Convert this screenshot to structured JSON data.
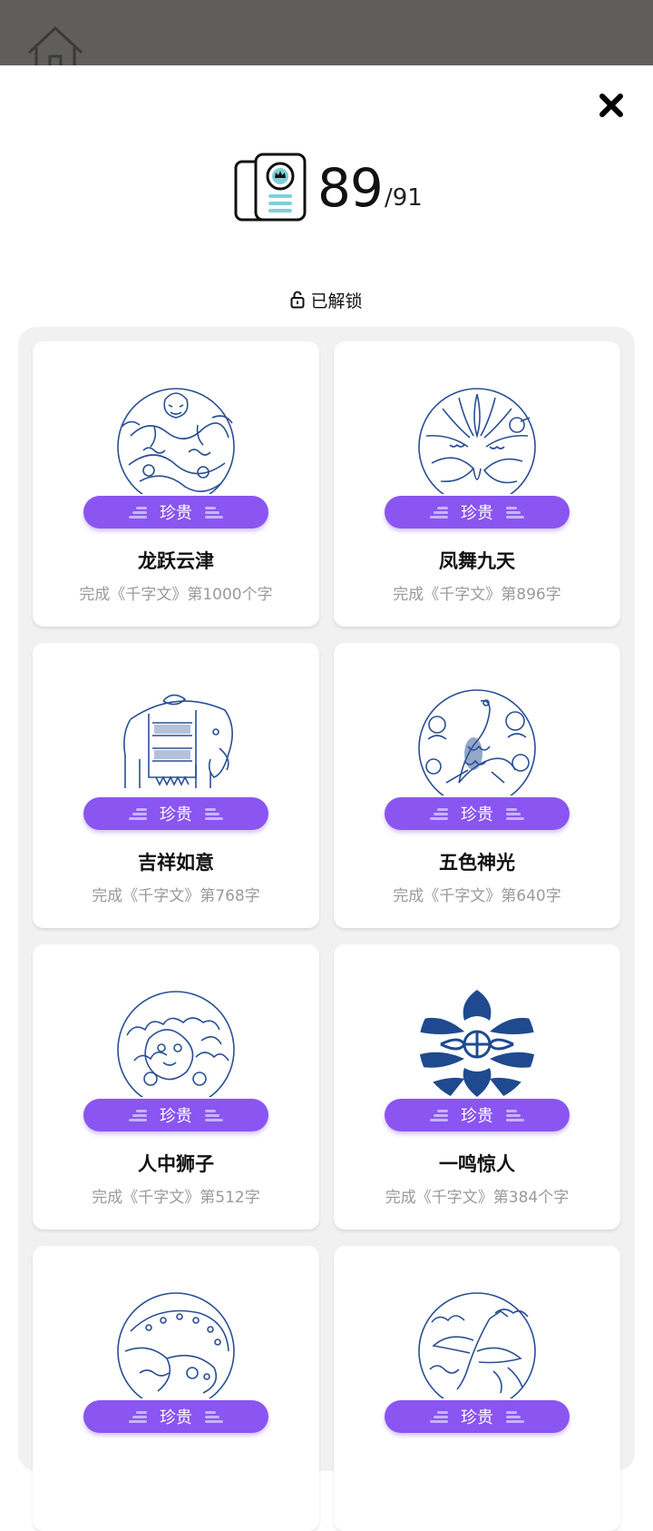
{
  "app": {
    "close_icon": "close-icon",
    "home_icon": "home-icon"
  },
  "counter": {
    "unlocked": "89",
    "total": "/91"
  },
  "unlocked_section": {
    "label": "已解锁",
    "icon": "unlock-icon"
  },
  "colors": {
    "badge": "#8a55f0",
    "art": "#2a4f94",
    "panel": "#f1f1f1"
  },
  "cards": [
    {
      "badge": "珍贵",
      "title": "龙跃云津",
      "desc": "完成《千字文》第1000个字",
      "art": "dragon"
    },
    {
      "badge": "珍贵",
      "title": "凤舞九天",
      "desc": "完成《千字文》第896字",
      "art": "phoenix"
    },
    {
      "badge": "珍贵",
      "title": "吉祥如意",
      "desc": "完成《千字文》第768字",
      "art": "elephant"
    },
    {
      "badge": "珍贵",
      "title": "五色神光",
      "desc": "完成《千字文》第640字",
      "art": "peacock"
    },
    {
      "badge": "珍贵",
      "title": "人中狮子",
      "desc": "完成《千字文》第512字",
      "art": "lion"
    },
    {
      "badge": "珍贵",
      "title": "一鸣惊人",
      "desc": "完成《千字文》第384个字",
      "art": "birds"
    },
    {
      "badge": "珍贵",
      "title": "",
      "desc": "",
      "art": "leopard"
    },
    {
      "badge": "珍贵",
      "title": "",
      "desc": "",
      "art": "cranes"
    }
  ]
}
